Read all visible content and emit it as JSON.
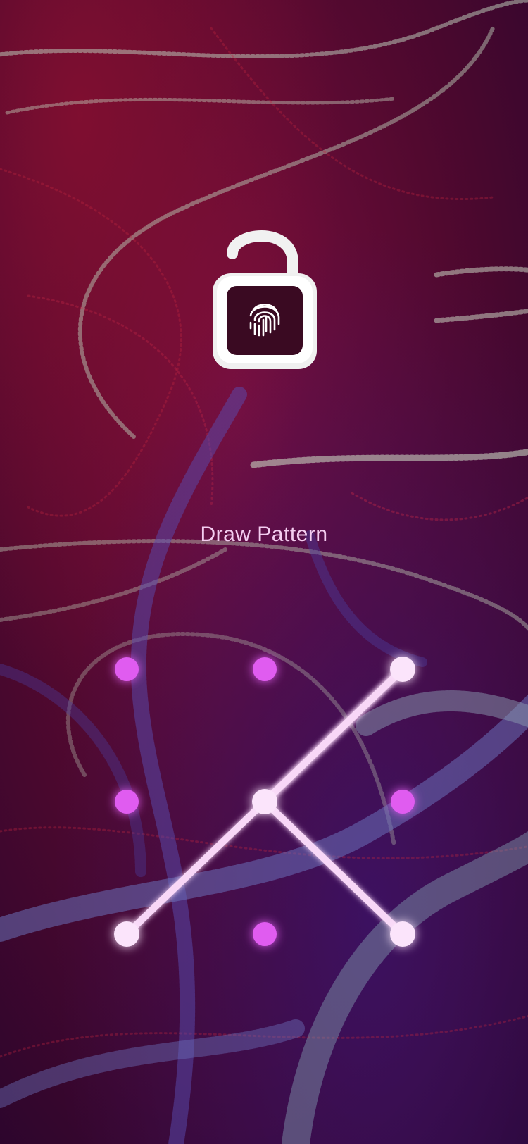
{
  "lock_screen": {
    "prompt_text": "Draw Pattern",
    "lock_icon": "padlock-open-fingerprint-icon",
    "pattern": {
      "grid_rows": 3,
      "grid_cols": 3,
      "dot_color": "#e05cf0",
      "active_dot_color": "#fbe4fb",
      "line_color": "#f8d7f7",
      "selected_sequence": [
        2,
        6,
        8,
        4
      ]
    },
    "colors": {
      "background": "#3a0628",
      "accent_magenta": "#d34fe6"
    }
  }
}
